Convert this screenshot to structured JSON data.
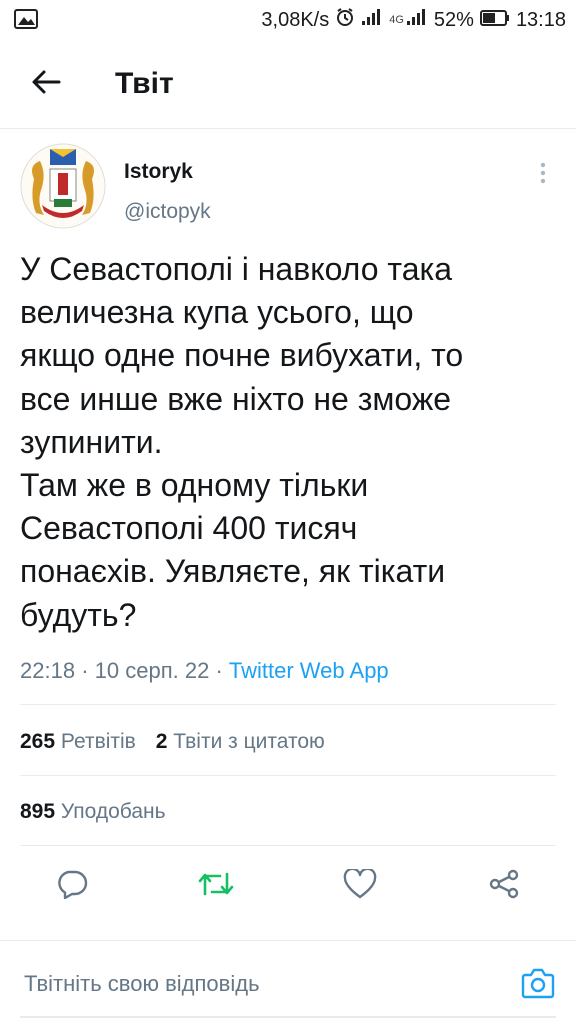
{
  "status_bar": {
    "speed": "3,08K/s",
    "network": "4G",
    "battery": "52%",
    "time": "13:18"
  },
  "header": {
    "title": "Твіт"
  },
  "tweet": {
    "author_name": "Istoryk",
    "author_handle": "@ictopyk",
    "text": "У Севастополі і навколо така\nвеличезна купа усього, що\nякщо одне почне вибухати, то\nвсе инше вже ніхто не зможе\nзупинити.\nТам же в одному тільки\nСевастополі 400 тисяч\nпонаєхів. Уявляєте, як тікати\nбудуть?",
    "time": "22:18",
    "date": "10 серп. 22",
    "separator": "·",
    "source": "Twitter Web App"
  },
  "stats": {
    "retweets_count": "265",
    "retweets_label": "Ретвітів",
    "quotes_count": "2",
    "quotes_label": "Твіти з цитатою",
    "likes_count": "895",
    "likes_label": "Уподобань"
  },
  "reply": {
    "placeholder": "Твітніть свою відповідь"
  },
  "colors": {
    "accent": "#1da1f2",
    "retweet": "#17bf63",
    "muted": "#657786",
    "text": "#14171a"
  },
  "icons": [
    "gallery-icon",
    "alarm-icon",
    "signal-icon",
    "battery-icon",
    "back-arrow-icon",
    "more-vertical-icon",
    "reply-icon",
    "retweet-icon",
    "like-icon",
    "share-icon",
    "camera-icon"
  ]
}
